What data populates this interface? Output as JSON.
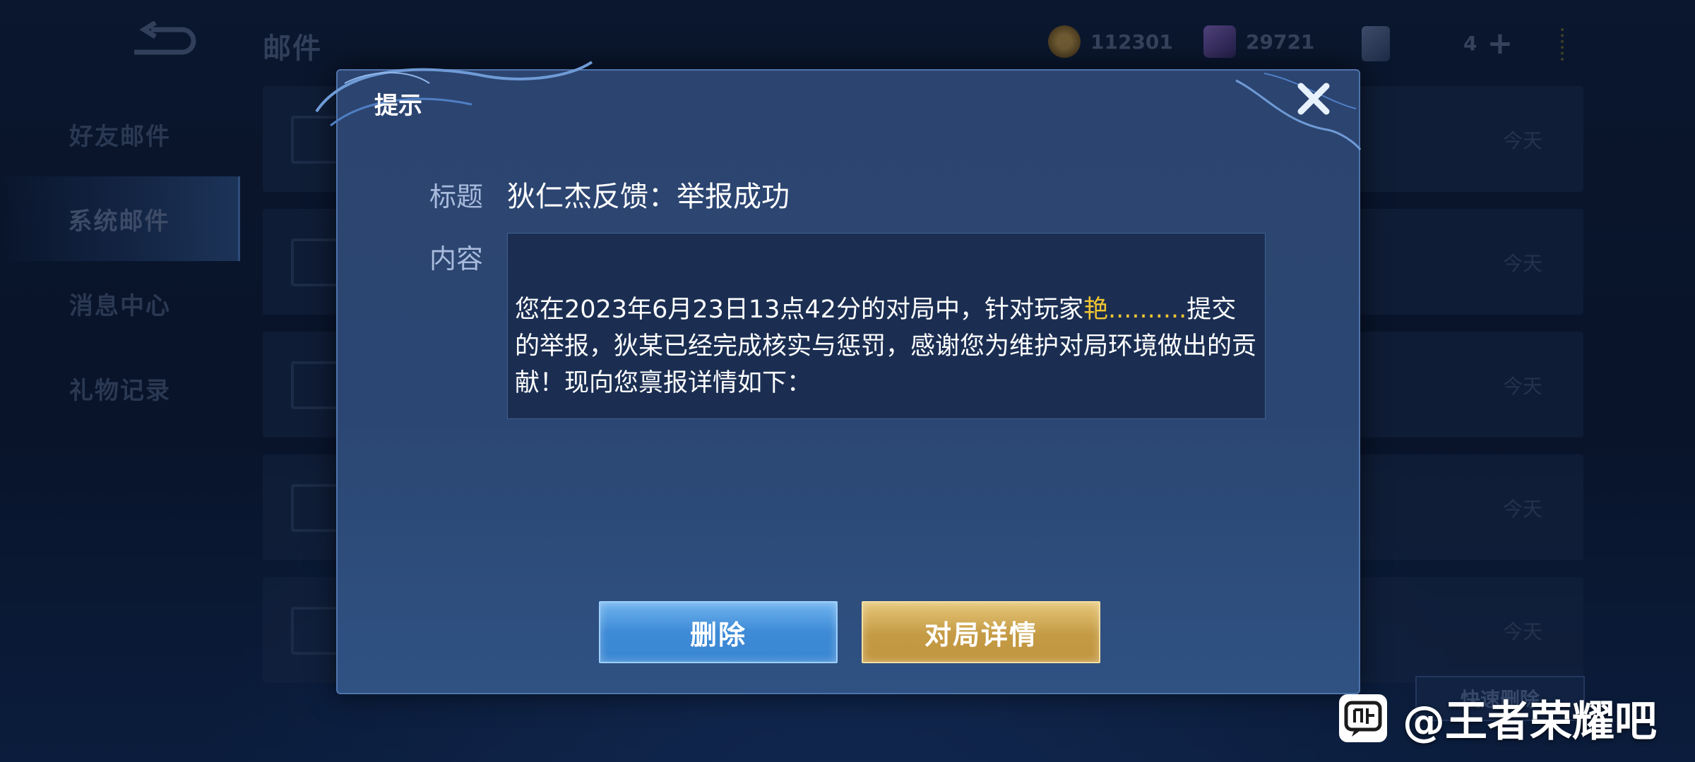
{
  "header": {
    "title": "邮件",
    "currencies": [
      {
        "icon": "gold-coin-icon",
        "value": "112301"
      },
      {
        "icon": "diamond-icon",
        "value": "29721"
      },
      {
        "icon": "card-icon",
        "value": "4"
      }
    ]
  },
  "sidebar": {
    "items": [
      {
        "label": "好友邮件"
      },
      {
        "label": "系统邮件"
      },
      {
        "label": "消息中心"
      },
      {
        "label": "礼物记录"
      }
    ],
    "active": "系统邮件"
  },
  "mail_list": {
    "dates": [
      "今天",
      "今天",
      "今天",
      "今天",
      "今天"
    ],
    "quick_delete": "快速删除"
  },
  "dialog": {
    "title": "提示",
    "subject_label": "标题",
    "subject": "狄仁杰反馈：举报成功",
    "content_label": "内容",
    "content_part1": "您在2023年6月23日13点42分的对局中，针对玩家",
    "content_player": "艳..........",
    "content_part2": "提交的举报，狄某已经完成核实与惩罚，感谢您为维护对局环境做出的贡献！现向您禀报详情如下：",
    "delete_button": "删除",
    "detail_button": "对局详情"
  },
  "watermark": {
    "text": "@王者荣耀吧",
    "logo": "tieba-logo-icon"
  },
  "colors": {
    "accent_gold": "#f2c531",
    "button_blue": "#3d8ad6",
    "button_gold": "#c49a44"
  }
}
